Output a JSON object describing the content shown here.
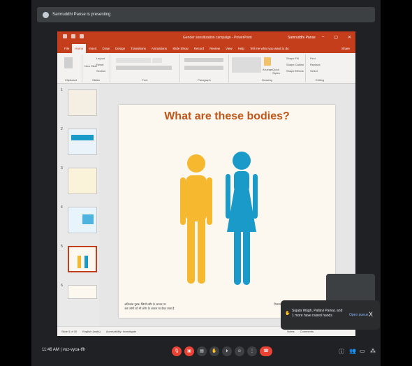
{
  "presenter": {
    "label": "Samruddhi Panse is presenting"
  },
  "powerpoint": {
    "title": "Gender sensitization campaign - PowerPoint",
    "user": "Samruddhi Panse",
    "tabs": [
      "File",
      "Home",
      "Insert",
      "Draw",
      "Design",
      "Transitions",
      "Animations",
      "Slide Show",
      "Record",
      "Review",
      "View",
      "Help",
      "Tell me what you want to do"
    ],
    "share_label": "Share",
    "ribbon": {
      "groups": [
        "Clipboard",
        "Slides",
        "Font",
        "Paragraph",
        "Drawing",
        "Editing"
      ],
      "new_slide": "New Slide",
      "layout": "Layout",
      "reset": "Reset",
      "section": "Section",
      "arrange": "Arrange",
      "quick_styles": "Quick Styles",
      "shape_fill": "Shape Fill",
      "shape_outline": "Shape Outline",
      "shape_effects": "Shape Effects",
      "find": "Find",
      "replace": "Replace",
      "select": "Select"
    },
    "thumb_numbers": [
      "1",
      "2",
      "3",
      "4",
      "5",
      "6"
    ],
    "slide": {
      "title": "What are these bodies?",
      "hindi_1": "अधिकांश पुरुष/ स्त्रियाँ शरीर के आधार पर",
      "hindi_2": "अतः लोगो को भी शरीर के आधार पर देखा जाता है",
      "hindi_r": "निकाय",
      "male_color": "#f5b82e",
      "female_color": "#1a9ac9"
    },
    "status": {
      "slide_of": "Slide 5 of 30",
      "language": "English (India)",
      "accessibility": "Accessibility: Investigate",
      "notes": "Notes",
      "comments": "Comments"
    }
  },
  "toast": {
    "message": "Sujata Wagh, Pallavi Pawar, and 1 more have raised hands",
    "action": "Open queue",
    "close": "X"
  },
  "meeting": {
    "time": "11:46 AM",
    "code": "vuz-vyca-tfh"
  }
}
